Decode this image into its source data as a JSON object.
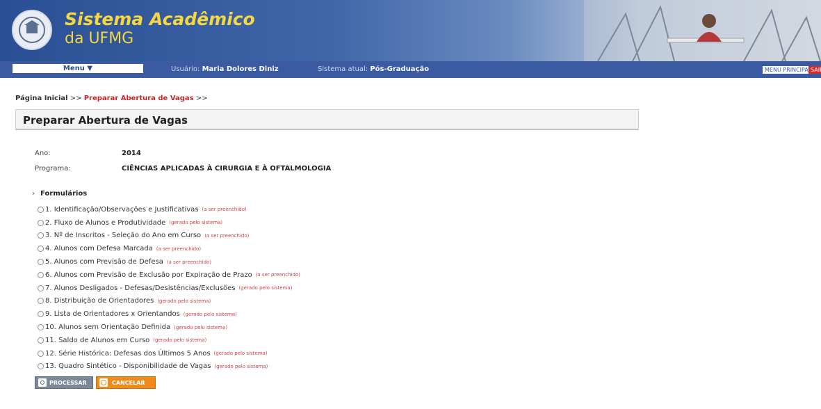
{
  "header": {
    "brand_line1": "Sistema Acadêmico",
    "brand_line2": "da UFMG",
    "brand_color": "#f5d742",
    "header_color": "#2a4f94"
  },
  "navbar": {
    "menu_label": "Menu ▼",
    "user_label": "Usuário:",
    "user_name": "Maria Dolores Diniz",
    "system_label": "Sistema atual:",
    "system_name": "Pós-Graduação",
    "menu_principal": "MENU PRINCIPAL",
    "sair": "SAIR"
  },
  "breadcrumb": {
    "home": "Página Inicial",
    "sep": ">>",
    "current": "Preparar Abertura de Vagas",
    "trail_end": ">>"
  },
  "page": {
    "title": "Preparar Abertura de Vagas",
    "ano_label": "Ano:",
    "ano_value": "2014",
    "programa_label": "Programa:",
    "programa_value": "CIÊNCIAS APLICADAS À CIRURGIA E À OFTALMOLOGIA"
  },
  "forms": {
    "heading": "Formulários",
    "items": [
      {
        "label": "1. Identificação/Observações e Justificativas",
        "note": "(a ser preenchido)"
      },
      {
        "label": "2. Fluxo de Alunos e Produtividade",
        "note": "(gerado pelo sistema)"
      },
      {
        "label": "3. Nº de Inscritos - Seleção do Ano em Curso",
        "note": "(a ser preenchido)"
      },
      {
        "label": "4. Alunos com Defesa Marcada",
        "note": "(a ser preenchido)"
      },
      {
        "label": "5. Alunos com Previsão de Defesa",
        "note": "(a ser preenchido)"
      },
      {
        "label": "6. Alunos com Previsão de Exclusão por Expiração de Prazo",
        "note": "(a ser preenchido)"
      },
      {
        "label": "7. Alunos Desligados - Defesas/Desistências/Exclusões",
        "note": "(gerado pelo sistema)"
      },
      {
        "label": "8. Distribuição de Orientadores",
        "note": "(gerado pelo sistema)"
      },
      {
        "label": "9. Lista de Orientadores x Orientandos",
        "note": "(gerado pelo sistema)"
      },
      {
        "label": "10. Alunos sem Orientação Definida",
        "note": "(gerado pelo sistema)"
      },
      {
        "label": "11. Saldo de Alunos em Curso",
        "note": "(gerado pelo sistema)"
      },
      {
        "label": "12. Série Histórica: Defesas dos Últimos 5 Anos",
        "note": "(gerado pelo sistema)"
      },
      {
        "label": "13. Quadro Sintético - Disponibilidade de Vagas",
        "note": "(gerado pelo sistema)"
      }
    ]
  },
  "actions": {
    "processar": "PROCESSAR",
    "cancelar": "CANCELAR"
  }
}
